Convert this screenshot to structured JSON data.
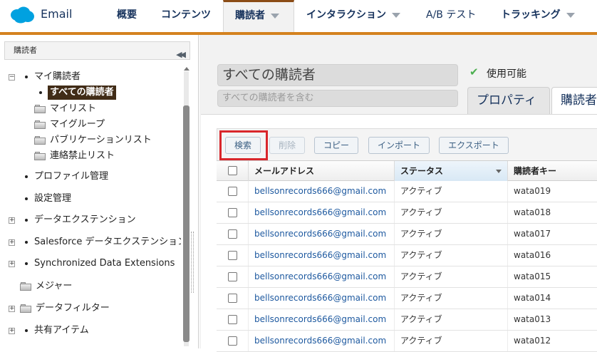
{
  "app": {
    "name": "Email"
  },
  "nav": {
    "tabs": [
      {
        "label": "概要",
        "has_caret": false
      },
      {
        "label": "コンテンツ",
        "has_caret": false
      },
      {
        "label": "購読者",
        "has_caret": true,
        "active": true
      },
      {
        "label": "インタラクション",
        "has_caret": true
      },
      {
        "label": "A/B テスト",
        "has_caret": false
      },
      {
        "label": "トラッキング",
        "has_caret": true
      }
    ]
  },
  "sidebar": {
    "title": "購読者",
    "tree": {
      "my_subscribers": "マイ購読者",
      "all_subscribers": "すべての購読者",
      "my_lists": "マイリスト",
      "my_groups": "マイグループ",
      "publication_lists": "パブリケーションリスト",
      "suppression_lists": "連絡禁止リスト",
      "profile_management": "プロファイル管理",
      "settings_management": "設定管理",
      "data_extensions": "データエクステンション",
      "sf_data_extensions": "Salesforce データエクステンション",
      "synced_data_extensions": "Synchronized Data Extensions",
      "measures": "メジャー",
      "data_filters": "データフィルター",
      "shared_items": "共有アイテム"
    }
  },
  "detail": {
    "name": "すべての購読者",
    "description_placeholder": "すべての購読者を含む",
    "status": "使用可能",
    "tabs": [
      "プロパティ",
      "購読者"
    ]
  },
  "toolbar": {
    "search": "検索",
    "delete": "削除",
    "copy": "コピー",
    "import": "インポート",
    "export": "エクスポート"
  },
  "table": {
    "columns": [
      "メールアドレス",
      "ステータス",
      "購読者キー"
    ],
    "rows": [
      {
        "email": "bellsonrecords666@gmail.com",
        "status": "アクティブ",
        "key": "wata019"
      },
      {
        "email": "bellsonrecords666@gmail.com",
        "status": "アクティブ",
        "key": "wata018"
      },
      {
        "email": "bellsonrecords666@gmail.com",
        "status": "アクティブ",
        "key": "wata017"
      },
      {
        "email": "bellsonrecords666@gmail.com",
        "status": "アクティブ",
        "key": "wata016"
      },
      {
        "email": "bellsonrecords666@gmail.com",
        "status": "アクティブ",
        "key": "wata015"
      },
      {
        "email": "bellsonrecords666@gmail.com",
        "status": "アクティブ",
        "key": "wata014"
      },
      {
        "email": "bellsonrecords666@gmail.com",
        "status": "アクティブ",
        "key": "wata013"
      },
      {
        "email": "bellsonrecords666@gmail.com",
        "status": "アクティブ",
        "key": "wata012"
      }
    ]
  },
  "colors": {
    "accent": "#d4821f",
    "selected_node": "#412c17",
    "link": "#1f5aa0",
    "highlight": "#d9262b"
  }
}
